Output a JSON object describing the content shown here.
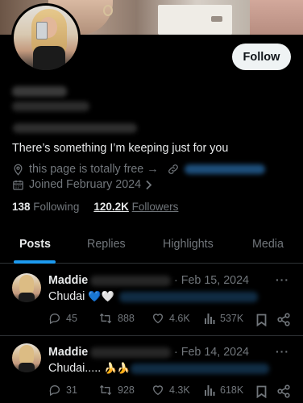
{
  "profile": {
    "follow_label": "Follow",
    "bio": "There’s something I’m keeping just for you",
    "location": "this page is totally free →",
    "joined": "Joined February 2024",
    "following_count": "138",
    "following_label": "Following",
    "followers_count": "120.2K",
    "followers_label": "Followers"
  },
  "tabs": [
    {
      "label": "Posts"
    },
    {
      "label": "Replies"
    },
    {
      "label": "Highlights"
    },
    {
      "label": "Media"
    }
  ],
  "posts": [
    {
      "author": "Maddie",
      "date": "· Feb 15, 2024",
      "text": "Chudai",
      "emoji": "💙🤍",
      "replies": "45",
      "reposts": "888",
      "likes": "4.6K",
      "views": "537K"
    },
    {
      "author": "Maddie",
      "date": "· Feb 14, 2024",
      "text": "Chudai.....",
      "emoji": "🍌🍌",
      "replies": "31",
      "reposts": "928",
      "likes": "4.3K",
      "views": "618K"
    }
  ],
  "colors": {
    "background": "#000000",
    "text": "#e7e9ea",
    "muted": "#71767b",
    "accent": "#1d9bf0",
    "divider": "#2f3336"
  }
}
